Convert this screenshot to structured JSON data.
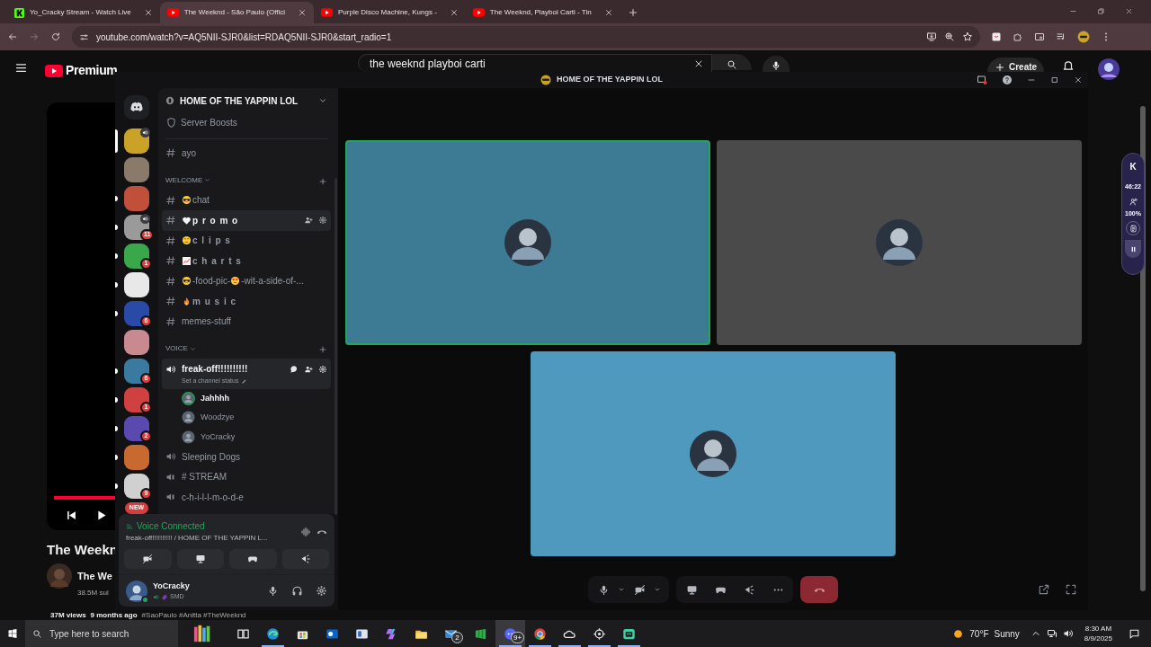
{
  "browser": {
    "tabs": [
      {
        "title": "Yo_Cracky Stream - Watch Live",
        "kind": "k",
        "selected": false
      },
      {
        "title": "The Weeknd - São Paulo (Offici",
        "kind": "play",
        "selected": true
      },
      {
        "title": "Purple Disco Machine, Kungs -",
        "kind": "play",
        "selected": false
      },
      {
        "title": "The Weeknd, Playboi Carti - Tin",
        "kind": "play",
        "selected": false
      }
    ],
    "url": "youtube.com/watch?v=AQ5NII-SJR0&list=RDAQ5NII-SJR0&start_radio=1"
  },
  "youtube": {
    "logo": "Premium",
    "search": "the weeknd playboi carti",
    "create": "Create",
    "title": "The Weekn",
    "channel": "The We",
    "subscribers": "38.5M sul",
    "views": "37M views",
    "age": "9 months ago",
    "tags": "#SaoPaulo #Anitta #TheWeeknd"
  },
  "discord": {
    "title": "HOME OF THE YAPPIN LOL",
    "servers": [
      {
        "color": "#c9a227",
        "selected": true,
        "unread": false,
        "voice": true
      },
      {
        "color": "#8a7a6a",
        "selected": false,
        "unread": false,
        "voice": false
      },
      {
        "color": "#c0503a",
        "selected": false,
        "unread": true,
        "voice": false
      },
      {
        "color": "#9a9a9a",
        "selected": false,
        "unread": true,
        "voice": true,
        "badge": "11"
      },
      {
        "color": "#3aa84a",
        "selected": false,
        "unread": true,
        "voice": false,
        "badge": "1"
      },
      {
        "color": "#e8e8e8",
        "selected": false,
        "unread": true,
        "voice": false
      },
      {
        "color": "#2a4aa8",
        "selected": false,
        "unread": true,
        "voice": false,
        "badge": "6"
      },
      {
        "color": "#c88a90",
        "selected": false,
        "unread": false,
        "voice": false
      },
      {
        "color": "#3a7aa0",
        "selected": false,
        "unread": true,
        "voice": false,
        "badge": "6"
      },
      {
        "color": "#d04040",
        "selected": false,
        "unread": true,
        "voice": false,
        "badge": "1"
      },
      {
        "color": "#5a4ab0",
        "selected": false,
        "unread": true,
        "voice": false,
        "badge": "2"
      },
      {
        "color": "#c86a30",
        "selected": false,
        "unread": true,
        "voice": false
      },
      {
        "color": "#d0d0d0",
        "selected": false,
        "unread": true,
        "voice": false,
        "badge": "9"
      }
    ],
    "new_pill": "NEW",
    "server_name": "HOME OF THE YAPPIN LOL",
    "boosts": "Server Boosts",
    "channels": [
      {
        "kind": "text",
        "segments": [
          {
            "text": "ayo"
          }
        ],
        "hovered": false
      },
      {
        "kind": "category",
        "name": "WELCOME"
      },
      {
        "kind": "text",
        "segments": [
          {
            "kind": "sunglasses"
          },
          {
            "text": "chat"
          }
        ],
        "hovered": false
      },
      {
        "kind": "text",
        "segments": [
          {
            "kind": "heart"
          },
          {
            "text": "p r o m o"
          }
        ],
        "hovered": true,
        "spaced": true
      },
      {
        "kind": "text",
        "segments": [
          {
            "kind": "dizzy"
          },
          {
            "text": "c l i p s"
          }
        ],
        "hovered": false,
        "spaced": true
      },
      {
        "kind": "text",
        "segments": [
          {
            "kind": "chart"
          },
          {
            "text": "c h a r t s"
          }
        ],
        "hovered": false,
        "spaced": true
      },
      {
        "kind": "text",
        "segments": [
          {
            "kind": "sunglasses"
          },
          {
            "text": "-food-pic-"
          },
          {
            "kind": "heart_eyes"
          },
          {
            "text": "-wit-a-side-of-..."
          }
        ],
        "hovered": false
      },
      {
        "kind": "text",
        "segments": [
          {
            "kind": "fire"
          },
          {
            "text": "m u s i c"
          }
        ],
        "hovered": false,
        "spaced": true
      },
      {
        "kind": "text",
        "segments": [
          {
            "text": "memes-stuff"
          }
        ],
        "hovered": false
      },
      {
        "kind": "category",
        "name": "VOICE"
      },
      {
        "kind": "voice",
        "name": "freak-off!!!!!!!!!!",
        "status": "Set a channel status",
        "connected": true,
        "members": [
          {
            "name": "Jahhhh",
            "speaking": true
          },
          {
            "name": "Woodzye",
            "speaking": false
          },
          {
            "name": "YoCracky",
            "speaking": false
          }
        ]
      },
      {
        "kind": "voice",
        "name": "Sleeping Dogs",
        "connected": false
      },
      {
        "kind": "stage",
        "name": "# STREAM",
        "connected": false
      },
      {
        "kind": "stage",
        "name": "c-h-i-l-l-m-o-d-e",
        "connected": false
      }
    ],
    "voice_panel": {
      "state": "Voice Connected",
      "location": "freak-off!!!!!!!!!! / HOME OF THE YAPPIN L..."
    },
    "user": {
      "name": "YoCracky",
      "status": "SMD"
    },
    "tiles": [
      {
        "color": "#3d7b94",
        "speaking": true
      },
      {
        "color": "#4a4a4a",
        "speaking": false
      },
      {
        "color": "#4f98be",
        "speaking": false
      }
    ]
  },
  "widget": {
    "logo": "K",
    "time": "46:22",
    "volume": "100%"
  },
  "taskbar": {
    "search": "Type here to search",
    "apps": [
      {
        "kind": "books",
        "running": false,
        "active": false
      },
      {
        "kind": "taskview",
        "running": false,
        "active": false
      },
      {
        "kind": "edge",
        "running": true,
        "active": false
      },
      {
        "kind": "store",
        "running": false,
        "active": false
      },
      {
        "kind": "mailo",
        "running": false,
        "active": false
      },
      {
        "kind": "board",
        "running": false,
        "active": false
      },
      {
        "kind": "copilot",
        "running": false,
        "active": false
      },
      {
        "kind": "folder",
        "running": false,
        "active": false
      },
      {
        "kind": "mail",
        "running": false,
        "active": false,
        "badge": "2"
      },
      {
        "kind": "green",
        "running": false,
        "active": false
      },
      {
        "kind": "chat",
        "running": true,
        "active": true,
        "badge": "9+"
      },
      {
        "kind": "chrome",
        "running": true,
        "active": false
      },
      {
        "kind": "cloud",
        "running": true,
        "active": false
      },
      {
        "kind": "steam",
        "running": true,
        "active": false
      },
      {
        "kind": "bot",
        "running": true,
        "active": false
      }
    ],
    "temp": "70°F",
    "weather": "Sunny",
    "time": "8:30 AM",
    "date": "8/9/2025"
  }
}
